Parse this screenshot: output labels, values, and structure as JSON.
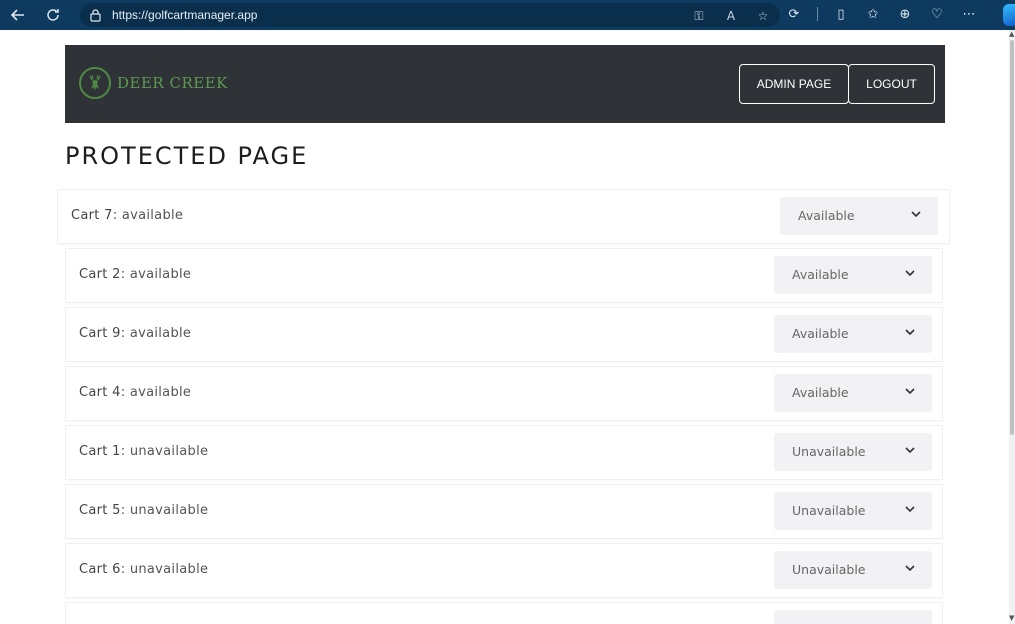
{
  "browser": {
    "url": "https://golfcartmanager.app"
  },
  "header": {
    "brand": "DEER CREEK",
    "admin_label": "ADMIN PAGE",
    "logout_label": "LOGOUT"
  },
  "page": {
    "title": "PROTECTED PAGE"
  },
  "carts": [
    {
      "name": "Cart 7",
      "status_text": "available",
      "selected": "Available"
    },
    {
      "name": "Cart 2",
      "status_text": "available",
      "selected": "Available"
    },
    {
      "name": "Cart 9",
      "status_text": "available",
      "selected": "Available"
    },
    {
      "name": "Cart 4",
      "status_text": "available",
      "selected": "Available"
    },
    {
      "name": "Cart 1",
      "status_text": "unavailable",
      "selected": "Unavailable"
    },
    {
      "name": "Cart 5",
      "status_text": "unavailable",
      "selected": "Unavailable"
    },
    {
      "name": "Cart 6",
      "status_text": "unavailable",
      "selected": "Unavailable"
    }
  ],
  "icons": {
    "back": "arrow-left-icon",
    "reload": "reload-icon",
    "lock": "lock-icon",
    "dropdown": "chevron-down-icon",
    "brand": "deer-logo-icon"
  },
  "colors": {
    "header_bg": "#2f3237",
    "brand_green": "#5c9a51",
    "select_bg": "#f2f2f5",
    "browser_bar": "#0d3a5e"
  }
}
